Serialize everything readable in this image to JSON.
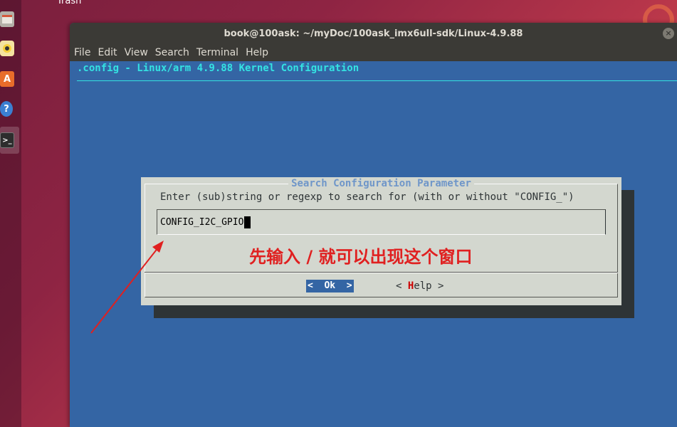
{
  "desktop": {
    "trash_label": "Trash",
    "dock_icons": [
      "files-icon",
      "rhythmbox-icon",
      "software-icon",
      "help-icon",
      "terminal-icon"
    ]
  },
  "window": {
    "title": "book@100ask: ~/myDoc/100ask_imx6ull-sdk/Linux-4.9.88",
    "menu": [
      "File",
      "Edit",
      "View",
      "Search",
      "Terminal",
      "Help"
    ]
  },
  "terminal": {
    "header": ".config - Linux/arm 4.9.88 Kernel Configuration",
    "bg_color": "#3465a4",
    "accent_color": "#34e2e2"
  },
  "dialog": {
    "title": "Search Configuration Parameter",
    "prompt": "Enter (sub)string or regexp to search for (with or without \"CONFIG_\")",
    "input_value": "CONFIG_I2C_GPIO",
    "ok_label": "<  Ok  >",
    "help_prefix": "< ",
    "help_hotkey": "H",
    "help_rest": "elp >"
  },
  "annotation": {
    "text": "先输入 / 就可以出现这个窗口",
    "color": "#e02020"
  }
}
